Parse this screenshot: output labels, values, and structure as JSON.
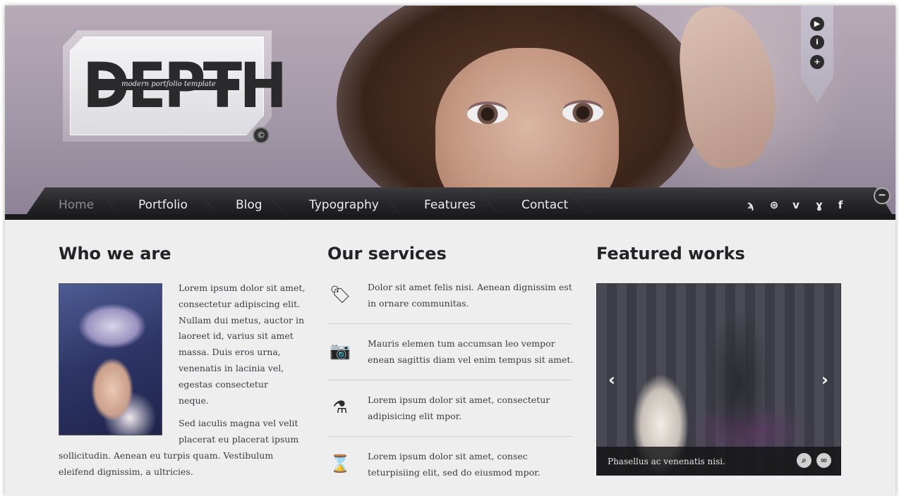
{
  "logo": {
    "title": "DEPTH",
    "tagline": "modern portfolio template",
    "badge": "©"
  },
  "side_controls": [
    {
      "icon": "play-icon",
      "glyph": "▶"
    },
    {
      "icon": "info-icon",
      "glyph": "i"
    },
    {
      "icon": "plus-icon",
      "glyph": "+"
    }
  ],
  "nav": {
    "items": [
      "Home",
      "Portfolio",
      "Blog",
      "Typography",
      "Features",
      "Contact"
    ],
    "active": "Home",
    "social": [
      {
        "icon": "rss-icon",
        "glyph": "ϡ"
      },
      {
        "icon": "dribbble-icon",
        "glyph": "⊛"
      },
      {
        "icon": "vimeo-icon",
        "glyph": "v"
      },
      {
        "icon": "twitter-icon",
        "glyph": "ɣ"
      },
      {
        "icon": "facebook-icon",
        "glyph": "f"
      }
    ],
    "collapse_glyph": "−"
  },
  "who": {
    "title": "Who we are",
    "para1_lines": [
      "Lorem ipsum dolor sit amet,",
      "consectetur adipiscing elit.",
      "Nullam dui metus, auctor in",
      "laoreet id, varius sit amet",
      "massa. Duis eros urna,",
      "venenatis in lacinia vel,",
      "egestas consectetur",
      "neque."
    ],
    "para2_lines_indented": [
      "Sed iaculis magna vel velit",
      "placerat eu placerat ipsum"
    ],
    "para2_lines_full": [
      "sollicitudin. Aenean eu turpis quam. Vestibulum",
      "eleifend dignissim, a ultricies."
    ]
  },
  "services": {
    "title": "Our services",
    "items": [
      {
        "icon": "price-tag-icon",
        "glyph": "🏷",
        "lines": [
          "Dolor sit amet felis nisi. Aenean dignissim est",
          "in ornare communitas."
        ]
      },
      {
        "icon": "camera-icon",
        "glyph": "📷",
        "lines": [
          "Mauris elemen tum accumsan leo vempor",
          "enean sagittis diam vel enim tempus sit amet."
        ]
      },
      {
        "icon": "flask-icon",
        "glyph": "⚗",
        "lines": [
          "Lorem ipsum dolor sit amet, consectetur",
          "adipisicing elit mpor."
        ]
      },
      {
        "icon": "hourglass-icon",
        "glyph": "⌛",
        "lines": [
          "Lorem ipsum dolor sit amet, consec",
          "teturpisiing elit, sed do eiusmod mpor."
        ]
      }
    ]
  },
  "featured": {
    "title": "Featured works",
    "caption": "Phasellus ac venenatis nisi.",
    "prev_glyph": "‹",
    "next_glyph": "›",
    "zoom_glyph": "⌕",
    "link_glyph": "∞"
  }
}
